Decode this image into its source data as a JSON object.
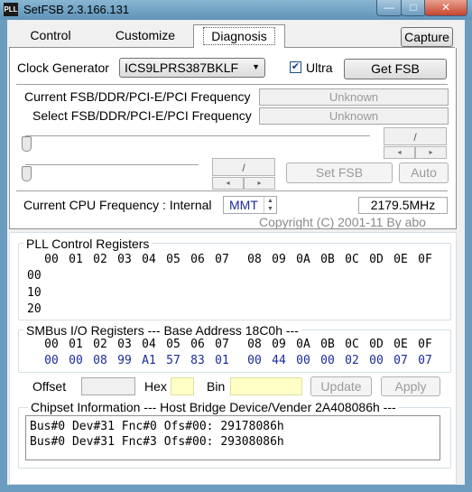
{
  "window": {
    "title": "SetFSB 2.3.166.131",
    "icon_text": "PLL"
  },
  "tabs": [
    {
      "label": "Control"
    },
    {
      "label": "Customize"
    },
    {
      "label": "Diagnosis"
    }
  ],
  "capture_label": "Capture",
  "clock_generator": {
    "label": "Clock Generator",
    "value": "ICS9LPRS387BKLF",
    "ultra_label": "Ultra",
    "ultra_checked": true
  },
  "get_fsb_label": "Get FSB",
  "current_freq": {
    "label": "Current FSB/DDR/PCI-E/PCI Frequency",
    "value": "Unknown"
  },
  "select_freq": {
    "label": "Select FSB/DDR/PCI-E/PCI Frequency",
    "value": "Unknown"
  },
  "spin1": {
    "value": "/",
    "up": "▸",
    "down": "◂"
  },
  "spin2": {
    "value": "/",
    "up": "▸",
    "down": "◂"
  },
  "set_fsb_label": "Set FSB",
  "auto_label": "Auto",
  "cpu_freq": {
    "label": "Current CPU Frequency : Internal",
    "source": "MMT",
    "value": "2179.5MHz"
  },
  "copyright": "Copyright (C) 2001-11 By abo",
  "pll": {
    "title": "PLL Control Registers",
    "headers": [
      "00",
      "01",
      "02",
      "03",
      "04",
      "05",
      "06",
      "07",
      "08",
      "09",
      "0A",
      "0B",
      "0C",
      "0D",
      "0E",
      "0F"
    ],
    "rows": [
      "00",
      "10",
      "20"
    ]
  },
  "smbus": {
    "title": "SMBus I/O Registers  --- Base Address 18C0h ---",
    "headers": [
      "00",
      "01",
      "02",
      "03",
      "04",
      "05",
      "06",
      "07",
      "08",
      "09",
      "0A",
      "0B",
      "0C",
      "0D",
      "0E",
      "0F"
    ],
    "row_label": "00",
    "values": [
      "00",
      "08",
      "99",
      "A1",
      "57",
      "83",
      "01",
      "00",
      "44",
      "00",
      "00",
      "02",
      "00",
      "07",
      "07"
    ]
  },
  "offset_label": "Offset",
  "hex_label": "Hex",
  "bin_label": "Bin",
  "update_label": "Update",
  "apply_label": "Apply",
  "chipset": {
    "title": "Chipset Information  --- Host Bridge Device/Vender 2A408086h ---",
    "lines": [
      "Bus#0 Dev#31 Fnc#0 Ofs#00: 29178086h",
      "Bus#0 Dev#31 Fnc#3 Ofs#00: 29308086h"
    ]
  },
  "colors": {
    "titlebar": "#6b9cbf",
    "blue_text": "#1c2a9c",
    "yellow": "#ffffc6"
  }
}
